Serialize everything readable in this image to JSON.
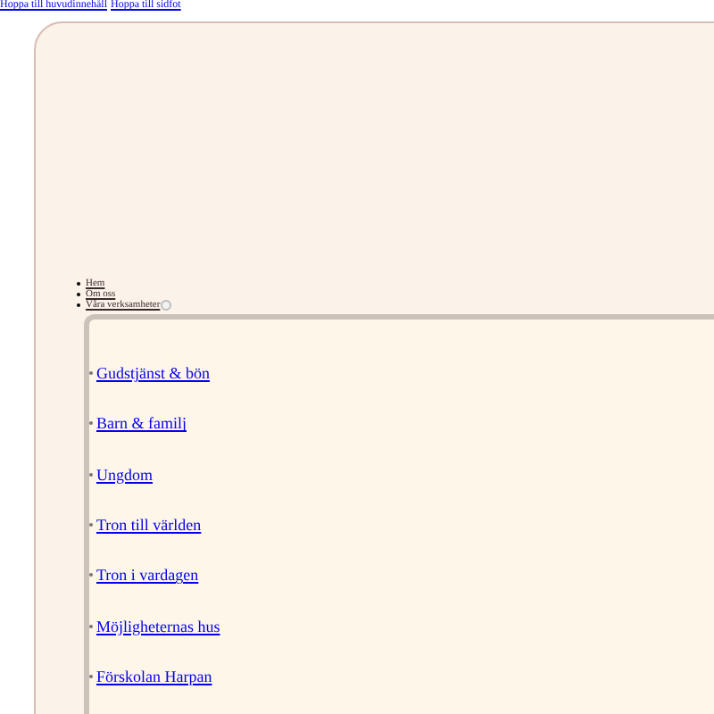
{
  "skip_links": [
    "Hoppa till huvudinnehåll",
    "Hoppa till sidfot"
  ],
  "nav": {
    "items": [
      {
        "label": "Hem"
      },
      {
        "label": "Om oss"
      },
      {
        "label": "Våra verksamheter",
        "expanded": true
      }
    ]
  },
  "submenu": {
    "items": [
      "Gudstjänst & bön",
      "Barn & familj",
      "Ungdom",
      "Tron till världen",
      "Tron i vardagen",
      "Möjligheternas hus",
      "Förskolan Harpan"
    ]
  }
}
